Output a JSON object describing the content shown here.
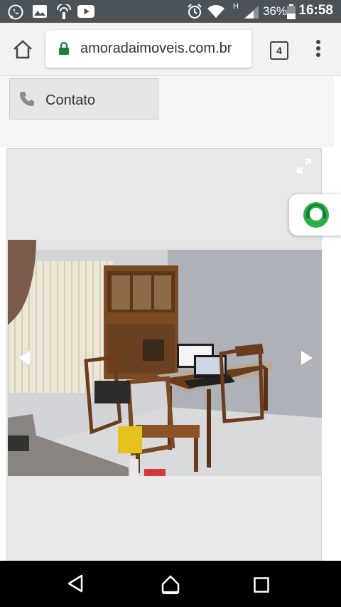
{
  "status_bar": {
    "notification_icons": [
      "whatsapp-icon",
      "image-icon",
      "wifi-calling-icon",
      "youtube-icon"
    ],
    "signal_letter": "H",
    "battery": "36%",
    "time": "16:58"
  },
  "browser": {
    "url": "amoradaimoveis.com.br",
    "tab_count": "4"
  },
  "page": {
    "contact_label": "Contato"
  },
  "gallery": {
    "photo_description_icons": [
      "expand-icon",
      "prev-arrow-icon",
      "next-arrow-icon"
    ]
  },
  "colors": {
    "status_bar": "#4b5258",
    "lock_green": "#188038",
    "chat_green": "#2ab24a"
  }
}
